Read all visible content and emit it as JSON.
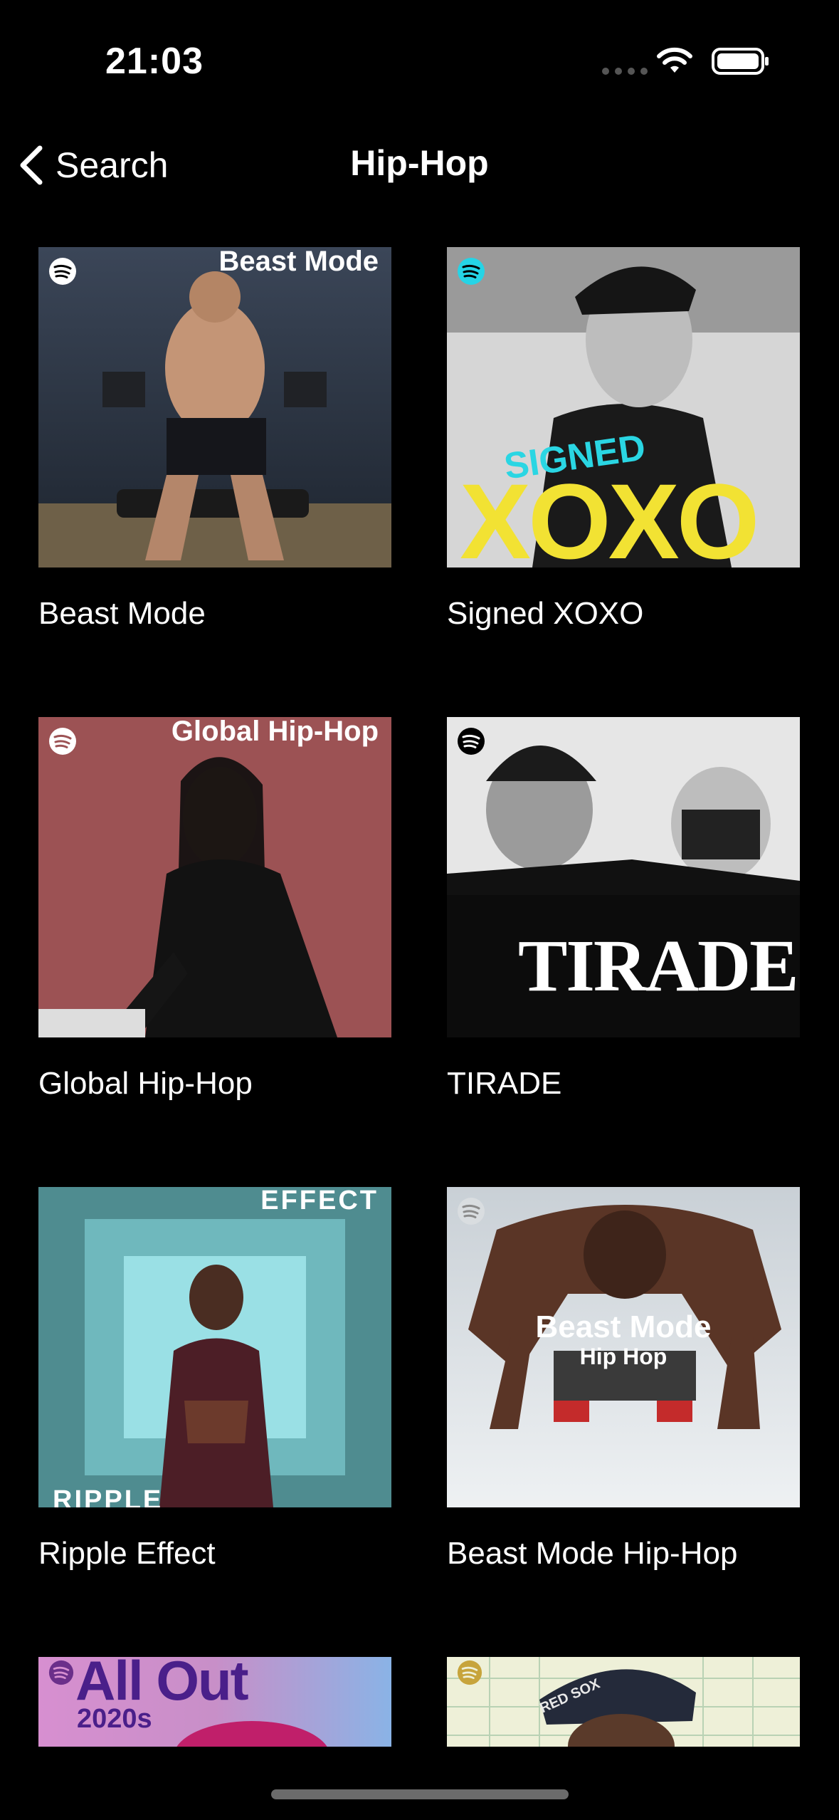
{
  "status": {
    "time": "21:03"
  },
  "nav": {
    "back_label": "Search",
    "title": "Hip-Hop"
  },
  "playlists": [
    {
      "label": "Beast Mode",
      "art_text": "Beast Mode"
    },
    {
      "label": "Signed XOXO",
      "art_text": "SIGNED",
      "art_text2": "XOXO"
    },
    {
      "label": "Global Hip-Hop",
      "art_text": "Global Hip-Hop"
    },
    {
      "label": "TIRADE",
      "art_text": "TIRADE"
    },
    {
      "label": "Ripple Effect",
      "art_text": "EFFECT",
      "art_text2": "RIPPLE"
    },
    {
      "label": "Beast Mode Hip-Hop",
      "art_text": "Beast Mode",
      "art_text2": "Hip Hop"
    },
    {
      "art_text": "All Out",
      "art_text2": "2020s"
    },
    {
      "art_text": "RED SOX"
    }
  ],
  "colors": {
    "accent_green": "#1ed760",
    "background": "#000000"
  }
}
